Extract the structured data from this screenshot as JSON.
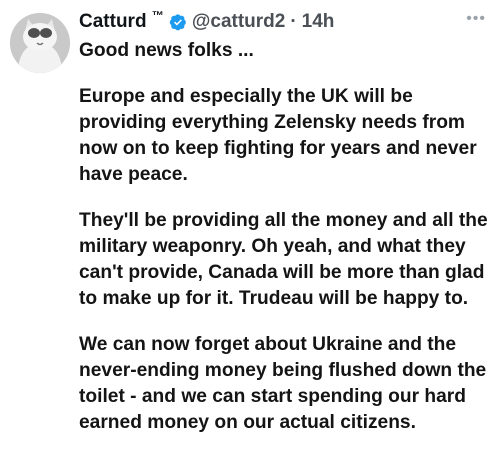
{
  "tweet": {
    "display_name": "Catturd",
    "tm": "™",
    "handle": "@catturd2",
    "separator": "·",
    "time": "14h",
    "more_icon": "more-horizontal-icon",
    "verified_color": "#1d9bf0",
    "paragraphs": [
      "Good news folks ...",
      "Europe and especially the UK will be providing everything Zelensky needs from now on to keep fighting for years and never have peace.",
      "They'll be providing all the money and all the military weaponry. Oh yeah, and what they can't provide, Canada will be more than glad to make up for it. Trudeau will be happy to.",
      "We can now forget about Ukraine and the never-ending money being flushed down the toilet - and we can start spending our hard earned money on our actual citizens."
    ]
  }
}
